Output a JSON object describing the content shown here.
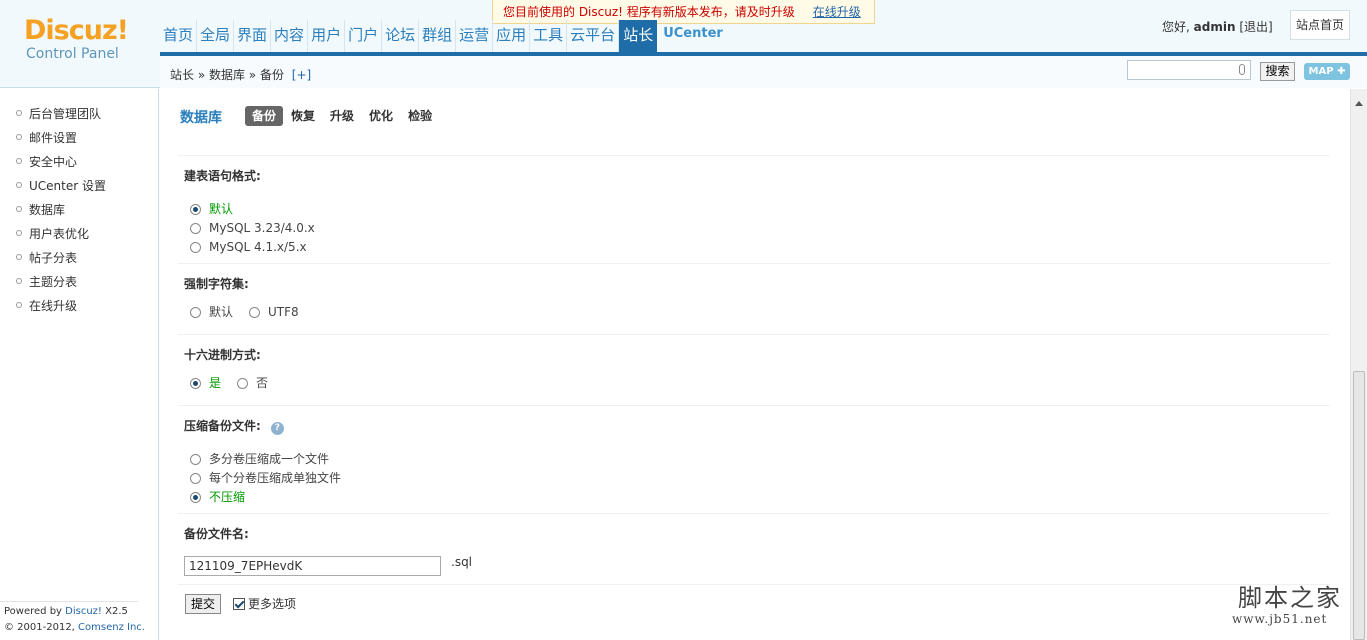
{
  "logo": {
    "title": "Discuz!",
    "subtitle": "Control Panel"
  },
  "notice": {
    "text": "您目前使用的 Discuz! 程序有新版本发布，请及时升级",
    "link": "在线升级"
  },
  "nav": [
    "首页",
    "全局",
    "界面",
    "内容",
    "用户",
    "门户",
    "论坛",
    "群组",
    "运营",
    "应用",
    "工具",
    "云平台",
    "站长",
    "UCenter"
  ],
  "nav_active": "站长",
  "user": {
    "greeting": "您好,",
    "name": "admin",
    "logout": "[退出]",
    "site_home": "站点首页"
  },
  "breadcrumb": {
    "path": "站长 » 数据库 » 备份",
    "plus": "[+]"
  },
  "search": {
    "button": "搜索",
    "map": "MAP"
  },
  "sidebar": {
    "items": [
      "后台管理团队",
      "邮件设置",
      "安全中心",
      "UCenter 设置",
      "数据库",
      "用户表优化",
      "帖子分表",
      "主题分表",
      "在线升级"
    ],
    "footer_line1_prefix": "Powered by ",
    "footer_brand": "Discuz!",
    "footer_version": " X2.5",
    "footer_line2_prefix": "© 2001-2012, ",
    "footer_company": "Comsenz Inc."
  },
  "main": {
    "title": "数据库",
    "tabs": [
      "备份",
      "恢复",
      "升级",
      "优化",
      "检验"
    ],
    "active_tab": "备份",
    "sql_format": {
      "label": "建表语句格式:",
      "options": [
        "默认",
        "MySQL 3.23/4.0.x",
        "MySQL 4.1.x/5.x"
      ],
      "selected": "默认"
    },
    "charset": {
      "label": "强制字符集:",
      "options": [
        "默认",
        "UTF8"
      ],
      "selected": null
    },
    "hex": {
      "label": "十六进制方式:",
      "options": [
        "是",
        "否"
      ],
      "selected": "是"
    },
    "compress": {
      "label": "压缩备份文件:",
      "options": [
        "多分卷压缩成一个文件",
        "每个分卷压缩成单独文件",
        "不压缩"
      ],
      "selected": "不压缩"
    },
    "filename": {
      "label": "备份文件名:",
      "value": "121109_7EPHevdK",
      "ext": ".sql"
    },
    "submit": "提交",
    "more_options": "更多选项"
  },
  "watermark": {
    "line1": "脚本之家",
    "line2": "www.jb51.net"
  },
  "colors": {
    "accent": "#1e6ca8",
    "link": "#2b7fbd",
    "selected": "#009900",
    "logo": "#f4a124"
  }
}
